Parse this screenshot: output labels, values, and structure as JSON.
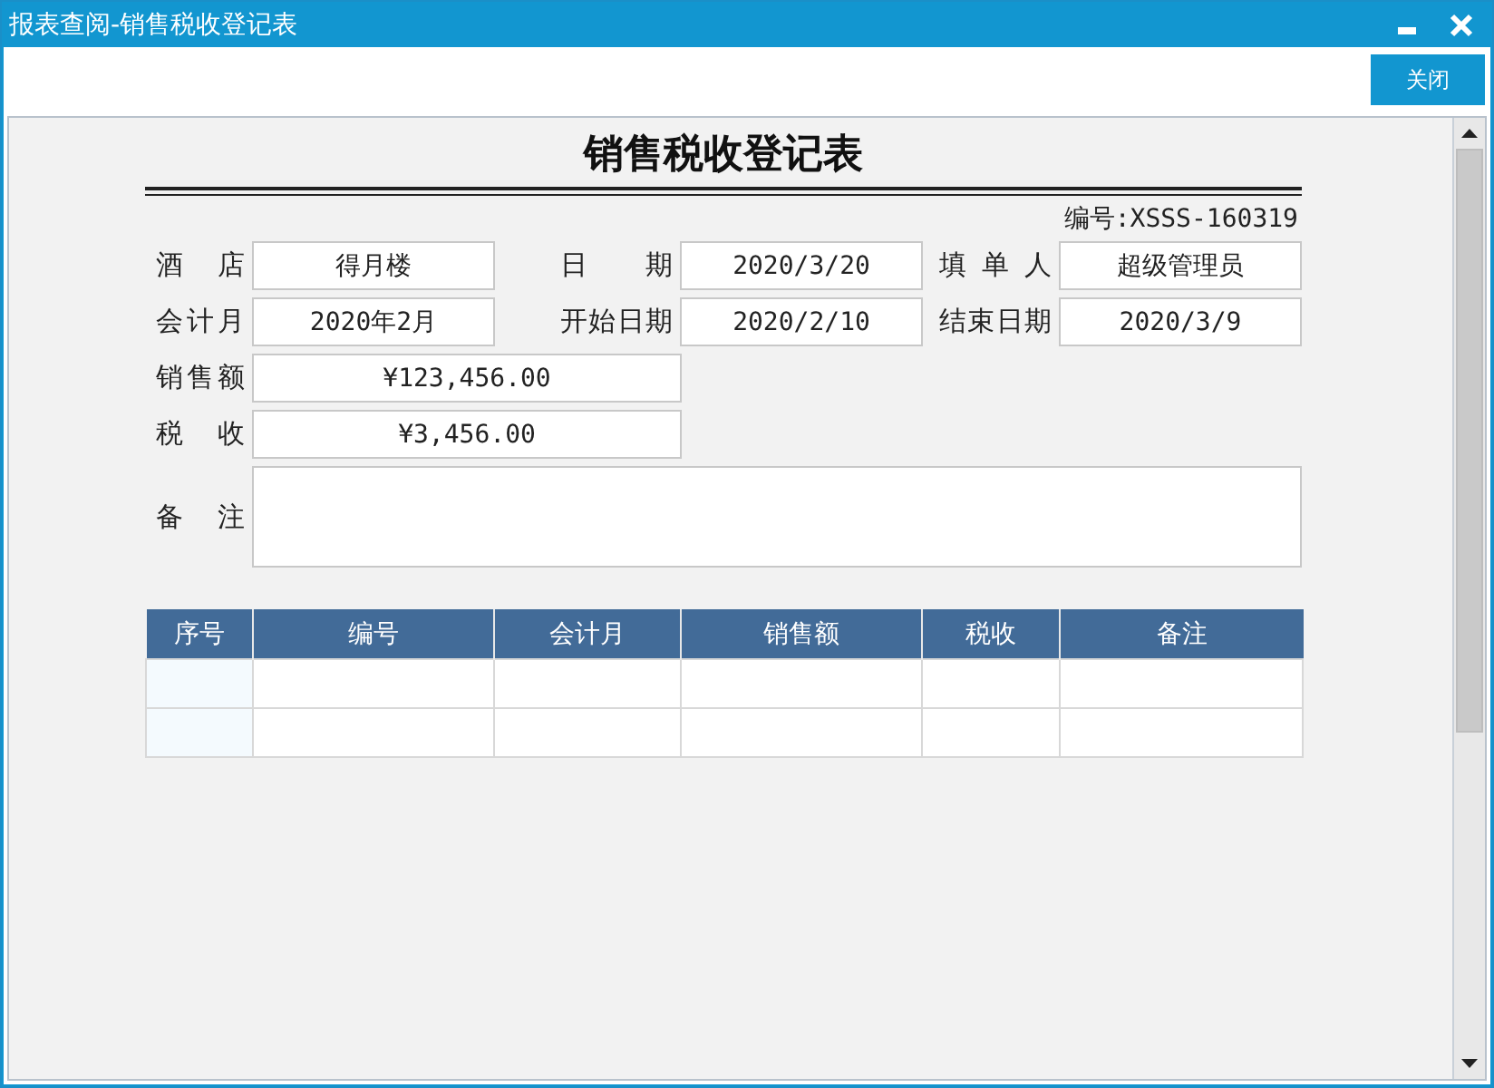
{
  "window": {
    "title": "报表查阅-销售税收登记表"
  },
  "toolbar": {
    "buttons": [
      "关闭"
    ]
  },
  "report": {
    "title": "销售税收登记表",
    "number": "编号:XSSS-160319",
    "form": [
      {
        "kind": "short",
        "label": "酒 店",
        "value": "得月楼"
      },
      {
        "kind": "short",
        "label": "日 期",
        "value": "2020/3/20"
      },
      {
        "kind": "short",
        "label": "填 单 人",
        "value": "超级管理员"
      },
      {
        "kind": "short",
        "label": "会计月",
        "value": "2020年2月"
      },
      {
        "kind": "short",
        "label": "开始日期",
        "value": "2020/2/10"
      },
      {
        "kind": "short",
        "label": "结束日期",
        "value": "2020/3/9"
      },
      {
        "kind": "wide",
        "label": "销售额",
        "value": "¥123,456.00"
      },
      {
        "kind": "wide",
        "label": "税 收",
        "value": "¥3,456.00"
      },
      {
        "kind": "area",
        "label": "备 注"
      }
    ]
  },
  "table": {
    "columns": [
      "序号",
      "编号",
      "会计月",
      "销售额",
      "税收",
      "备注"
    ],
    "rows": [
      {
        "kind": "empty"
      },
      {
        "kind": "empty"
      }
    ]
  }
}
